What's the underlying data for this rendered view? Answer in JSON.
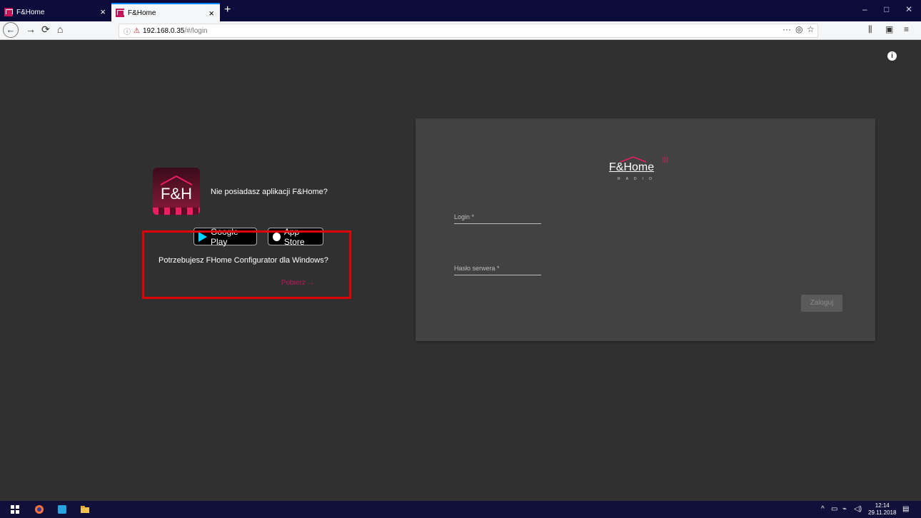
{
  "browser": {
    "tabs": [
      {
        "title": "F&Home"
      },
      {
        "title": "F&Home"
      }
    ],
    "url_host": "192.168.0.35",
    "url_path": "/#/login"
  },
  "app_promo": {
    "icon_text": "F&H",
    "question": "Nie posiadasz aplikacji F&Home?",
    "google_play_label": "Google Play",
    "app_store_label": "App Store",
    "configurator_question": "Potrzebujesz FHome Configurator dla Windows?",
    "download_label": "Pobierz →"
  },
  "login_card": {
    "logo_text": "F&Home",
    "logo_sub": "RADIO",
    "login_label": "Login *",
    "password_label": "Hasło serwera *",
    "submit_label": "Zaloguj"
  },
  "taskbar": {
    "time": "12:14",
    "date": "29.11.2018"
  },
  "colors": {
    "accent": "#c2185b",
    "highlight": "#e00000"
  }
}
